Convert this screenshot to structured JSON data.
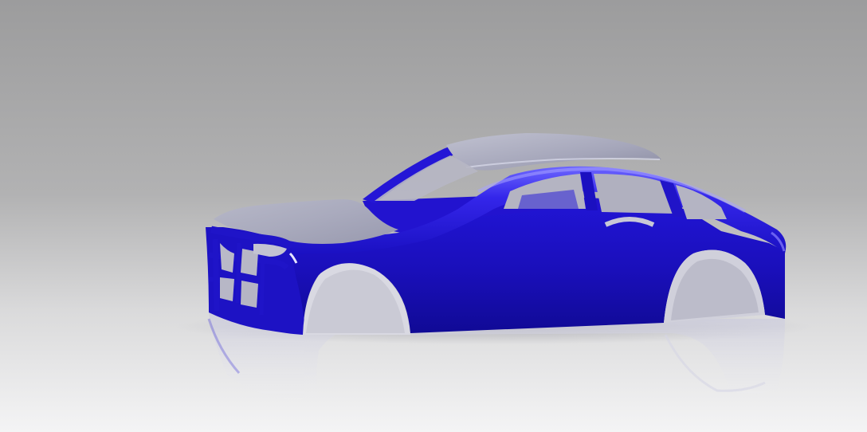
{
  "scene": {
    "subject": "car-body-shell-render",
    "colors": {
      "background_top": "#9d9d9e",
      "background_bottom": "#f3f3f4",
      "body_blue": "#1d10c9",
      "body_blue_dark": "#0c0887",
      "body_blue_light": "#5a52f2",
      "roof_gray": "#b2b3c4",
      "roof_gray_dark": "#8e8fa6",
      "reflection": "#c7c8dc"
    }
  }
}
